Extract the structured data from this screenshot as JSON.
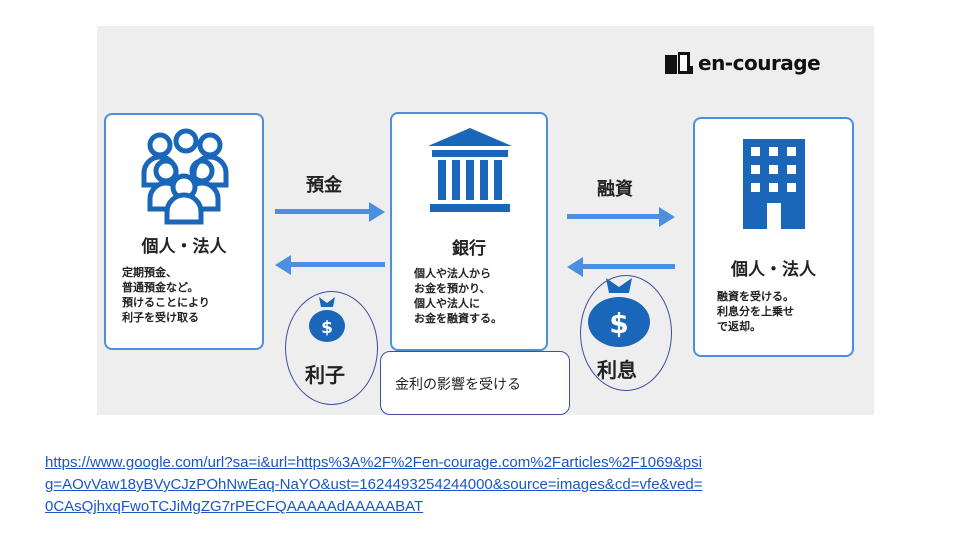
{
  "brand": {
    "name": "en-courage"
  },
  "left_box": {
    "title": "個人・法人",
    "lines": [
      "定期預金、",
      "普通預金など。",
      "預けることにより",
      "利子を受け取る"
    ]
  },
  "center_box": {
    "title": "銀行",
    "lines": [
      "個人や法人から",
      "お金を預かり、",
      "個人や法人に",
      "お金を融資する。"
    ]
  },
  "right_box": {
    "title": "個人・法人",
    "lines": [
      "融資を受ける。",
      "利息分を上乗せ",
      "で返却。"
    ]
  },
  "flows": {
    "deposit_label": "預金",
    "loan_label": "融資"
  },
  "circles": {
    "interest_received": "利子",
    "interest_paid": "利息"
  },
  "callout": {
    "text": "金利の影響を受ける"
  },
  "source_url": "https://www.google.com/url?sa=i&url=https%3A%2F%2Fen-courage.com%2Farticles%2F1069&psig=AOvVaw18yBVyCJzPOhNwEaq-NaYO&ust=1624493254244000&source=images&cd=vfe&ved=0CAsQjhxqFwoTCJiMgZG7rPECFQAAAAAdAAAAABAT",
  "colors": {
    "accent": "#4a8fe0",
    "icon": "#1a66b8",
    "panel": "#eeeeee"
  },
  "icons": [
    "people-group-icon",
    "bank-building-icon",
    "office-building-icon",
    "money-bag-icon"
  ]
}
